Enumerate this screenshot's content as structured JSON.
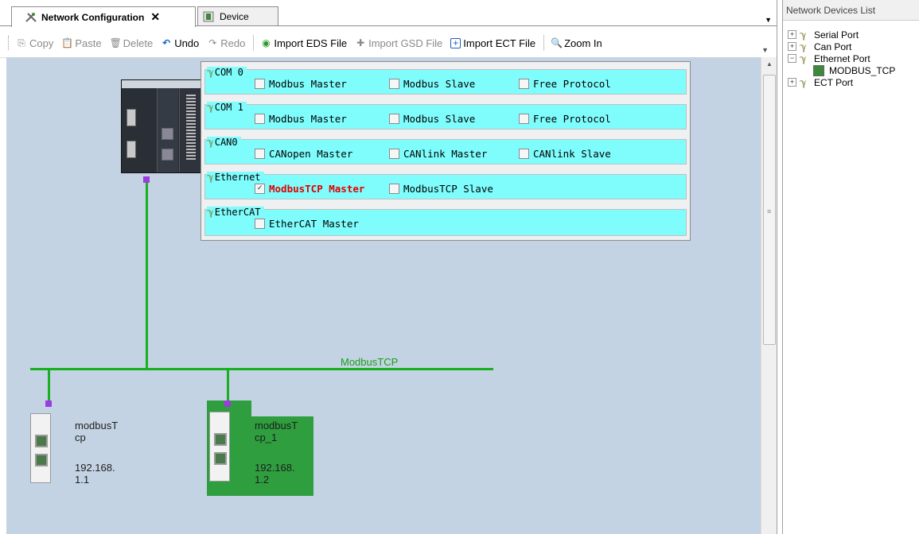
{
  "tabs": [
    {
      "label": "Network Configuration",
      "active": true,
      "icon": "network-config-icon"
    },
    {
      "label": "Device",
      "active": false,
      "icon": "device-icon"
    }
  ],
  "toolbar": {
    "copy": "Copy",
    "paste": "Paste",
    "delete": "Delete",
    "undo": "Undo",
    "redo": "Redo",
    "import_eds": "Import EDS File",
    "import_gsd": "Import GSD File",
    "import_ect": "Import ECT File",
    "zoom_in": "Zoom In"
  },
  "config": {
    "groups": [
      {
        "title": "COM 0",
        "options": [
          {
            "label": "Modbus Master",
            "checked": false
          },
          {
            "label": "Modbus Slave",
            "checked": false
          },
          {
            "label": "Free Protocol",
            "checked": false
          }
        ]
      },
      {
        "title": "COM 1",
        "options": [
          {
            "label": "Modbus Master",
            "checked": false
          },
          {
            "label": "Modbus Slave",
            "checked": false
          },
          {
            "label": "Free Protocol",
            "checked": false
          }
        ]
      },
      {
        "title": "CAN0",
        "options": [
          {
            "label": "CANopen Master",
            "checked": false
          },
          {
            "label": "CANlink Master",
            "checked": false
          },
          {
            "label": "CANlink Slave",
            "checked": false
          }
        ]
      },
      {
        "title": "Ethernet",
        "options": [
          {
            "label": "ModbusTCP Master",
            "checked": true
          },
          {
            "label": "ModbusTCP Slave",
            "checked": false
          }
        ]
      },
      {
        "title": "EtherCAT",
        "options": [
          {
            "label": "EtherCAT Master",
            "checked": false
          }
        ]
      }
    ]
  },
  "network": {
    "bus_label": "ModbusTCP",
    "slaves": [
      {
        "name_line1": "modbusT",
        "name_line2": "cp",
        "ip_line1": "192.168.",
        "ip_line2": "1.1",
        "selected": false
      },
      {
        "name_line1": "modbusT",
        "name_line2": "cp_1",
        "ip_line1": "192.168.",
        "ip_line2": "1.2",
        "selected": true
      }
    ],
    "colors": {
      "bus": "#18b020",
      "connector": "#9b3be0",
      "selected": "#2e9e3e",
      "canvas": "#c4d3e3",
      "config_group": "#7ffdfd"
    }
  },
  "right_panel": {
    "title": "Network Devices List",
    "tree": [
      {
        "label": "Serial Port",
        "expanded": false
      },
      {
        "label": "Can Port",
        "expanded": false
      },
      {
        "label": "Ethernet Port",
        "expanded": true
      },
      {
        "label": "MODBUS_TCP",
        "child": true
      },
      {
        "label": "ECT Port",
        "expanded": false
      }
    ]
  }
}
